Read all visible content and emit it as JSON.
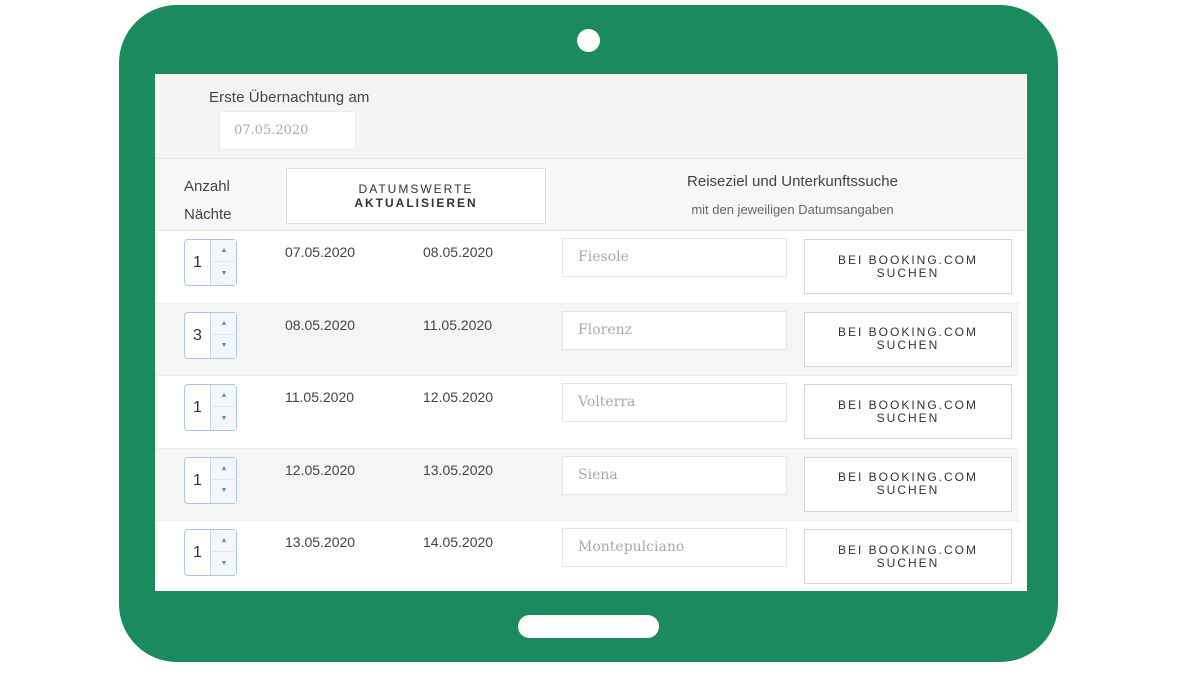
{
  "first_night": {
    "label": "Erste Übernachtung am",
    "value": "07.05.2020"
  },
  "header": {
    "nights_line1": "Anzahl",
    "nights_line2": "Nächte",
    "update_line1": "DATUMSWERTE",
    "update_line2": "AKTUALISIEREN",
    "search_title": "Reiseziel und Unterkunftssuche",
    "search_subtitle": "mit den jeweiligen Datumsangaben"
  },
  "rows": [
    {
      "nights": "1",
      "from": "07.05.2020",
      "to": "08.05.2020",
      "destination": "Fiesole",
      "btn_line1": "BEI BOOKING.COM",
      "btn_line2": "SUCHEN"
    },
    {
      "nights": "3",
      "from": "08.05.2020",
      "to": "11.05.2020",
      "destination": "Florenz",
      "btn_line1": "BEI BOOKING.COM",
      "btn_line2": "SUCHEN"
    },
    {
      "nights": "1",
      "from": "11.05.2020",
      "to": "12.05.2020",
      "destination": "Volterra",
      "btn_line1": "BEI BOOKING.COM",
      "btn_line2": "SUCHEN"
    },
    {
      "nights": "1",
      "from": "12.05.2020",
      "to": "13.05.2020",
      "destination": "Siena",
      "btn_line1": "BEI BOOKING.COM",
      "btn_line2": "SUCHEN"
    },
    {
      "nights": "1",
      "from": "13.05.2020",
      "to": "14.05.2020",
      "destination": "Montepulciano",
      "btn_line1": "BEI BOOKING.COM",
      "btn_line2": "SUCHEN"
    }
  ],
  "icons": {
    "step_up": "triangle-up-icon",
    "step_down": "triangle-down-icon"
  },
  "colors": {
    "device_frame": "#1c8a5f",
    "stepper_accent": "#4a90d9"
  }
}
